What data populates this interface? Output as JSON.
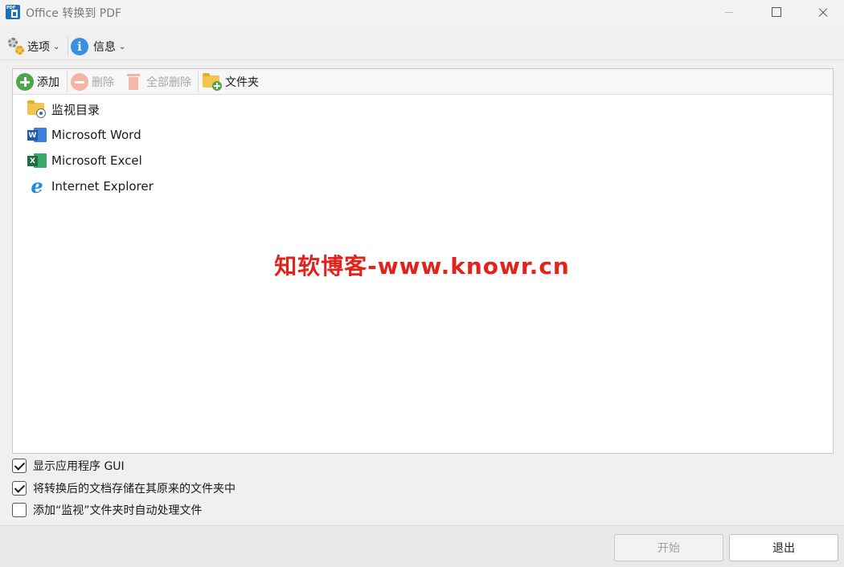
{
  "window": {
    "title": "Office 转换到 PDF",
    "icon": "app-pdf-icon"
  },
  "menubar": {
    "options_label": "选项",
    "info_label": "信息"
  },
  "toolbar": {
    "add_label": "添加",
    "remove_label": "删除",
    "remove_all_label": "全部删除",
    "folder_label": "文件夹"
  },
  "list": {
    "items": [
      {
        "label": "监视目录",
        "icon": "watch-folder-icon"
      },
      {
        "label": "Microsoft Word",
        "icon": "word-icon"
      },
      {
        "label": "Microsoft Excel",
        "icon": "excel-icon"
      },
      {
        "label": "Internet Explorer",
        "icon": "ie-icon"
      }
    ]
  },
  "watermark": "知软博客-www.knowr.cn",
  "options": {
    "show_gui": {
      "label": "显示应用程序 GUI",
      "checked": true
    },
    "save_original_folder": {
      "label": "将转换后的文档存储在其原来的文件夹中",
      "checked": true
    },
    "auto_process": {
      "label": "添加“监视”文件夹时自动处理文件",
      "checked": false
    }
  },
  "footer": {
    "start_label": "开始",
    "exit_label": "退出"
  },
  "colors": {
    "watermark": "#e3221b",
    "add_green": "#4aa84a",
    "accent_blue": "#1f6fb2"
  }
}
